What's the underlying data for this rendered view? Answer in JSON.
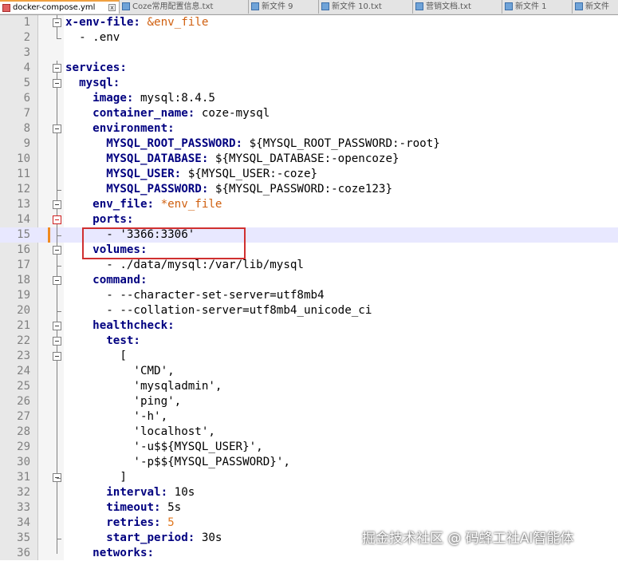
{
  "tabs": [
    {
      "label": "docker-compose.yml",
      "active": true
    },
    {
      "label": "Coze常用配置信息.txt",
      "active": false
    },
    {
      "label": "新文件 9",
      "active": false
    },
    {
      "label": "新文件 10.txt",
      "active": false
    },
    {
      "label": "营销文档.txt",
      "active": false
    },
    {
      "label": "新文件 1",
      "active": false
    },
    {
      "label": "新文件",
      "active": false
    }
  ],
  "tab_close_glyph": "x",
  "current_line": 15,
  "lines": [
    {
      "n": "1",
      "parts": [
        [
          "k",
          "x-env-file:"
        ],
        [
          "p",
          " "
        ],
        [
          "anc",
          "&env_file"
        ]
      ]
    },
    {
      "n": "2",
      "parts": [
        [
          "p",
          "  - .env"
        ]
      ]
    },
    {
      "n": "3",
      "parts": []
    },
    {
      "n": "4",
      "parts": [
        [
          "k",
          "services:"
        ]
      ]
    },
    {
      "n": "5",
      "parts": [
        [
          "p",
          "  "
        ],
        [
          "k",
          "mysql:"
        ]
      ]
    },
    {
      "n": "6",
      "parts": [
        [
          "p",
          "    "
        ],
        [
          "k",
          "image:"
        ],
        [
          "p",
          " mysql:8.4.5"
        ]
      ]
    },
    {
      "n": "7",
      "parts": [
        [
          "p",
          "    "
        ],
        [
          "k",
          "container_name:"
        ],
        [
          "p",
          " coze-mysql"
        ]
      ]
    },
    {
      "n": "8",
      "parts": [
        [
          "p",
          "    "
        ],
        [
          "k",
          "environment:"
        ]
      ]
    },
    {
      "n": "9",
      "parts": [
        [
          "p",
          "      "
        ],
        [
          "k",
          "MYSQL_ROOT_PASSWORD:"
        ],
        [
          "p",
          " ${MYSQL_ROOT_PASSWORD:-root}"
        ]
      ]
    },
    {
      "n": "10",
      "parts": [
        [
          "p",
          "      "
        ],
        [
          "k",
          "MYSQL_DATABASE:"
        ],
        [
          "p",
          " ${MYSQL_DATABASE:-opencoze}"
        ]
      ]
    },
    {
      "n": "11",
      "parts": [
        [
          "p",
          "      "
        ],
        [
          "k",
          "MYSQL_USER:"
        ],
        [
          "p",
          " ${MYSQL_USER:-coze}"
        ]
      ]
    },
    {
      "n": "12",
      "parts": [
        [
          "p",
          "      "
        ],
        [
          "k",
          "MYSQL_PASSWORD:"
        ],
        [
          "p",
          " ${MYSQL_PASSWORD:-coze123}"
        ]
      ]
    },
    {
      "n": "13",
      "parts": [
        [
          "p",
          "    "
        ],
        [
          "k",
          "env_file:"
        ],
        [
          "p",
          " "
        ],
        [
          "anc",
          "*env_file"
        ]
      ]
    },
    {
      "n": "14",
      "parts": [
        [
          "p",
          "    "
        ],
        [
          "k",
          "ports:"
        ]
      ]
    },
    {
      "n": "15",
      "parts": [
        [
          "p",
          "      - '3366:3306'"
        ]
      ]
    },
    {
      "n": "16",
      "parts": [
        [
          "p",
          "    "
        ],
        [
          "k",
          "volumes:"
        ]
      ]
    },
    {
      "n": "17",
      "parts": [
        [
          "p",
          "      - ./data/mysql:/var/lib/mysql"
        ]
      ]
    },
    {
      "n": "18",
      "parts": [
        [
          "p",
          "    "
        ],
        [
          "k",
          "command:"
        ]
      ]
    },
    {
      "n": "19",
      "parts": [
        [
          "p",
          "      - --character-set-server=utf8mb4"
        ]
      ]
    },
    {
      "n": "20",
      "parts": [
        [
          "p",
          "      - --collation-server=utf8mb4_unicode_ci"
        ]
      ]
    },
    {
      "n": "21",
      "parts": [
        [
          "p",
          "    "
        ],
        [
          "k",
          "healthcheck:"
        ]
      ]
    },
    {
      "n": "22",
      "parts": [
        [
          "p",
          "      "
        ],
        [
          "k",
          "test:"
        ]
      ]
    },
    {
      "n": "23",
      "parts": [
        [
          "p",
          "        ["
        ]
      ]
    },
    {
      "n": "24",
      "parts": [
        [
          "p",
          "          'CMD',"
        ]
      ]
    },
    {
      "n": "25",
      "parts": [
        [
          "p",
          "          'mysqladmin',"
        ]
      ]
    },
    {
      "n": "26",
      "parts": [
        [
          "p",
          "          'ping',"
        ]
      ]
    },
    {
      "n": "27",
      "parts": [
        [
          "p",
          "          '-h',"
        ]
      ]
    },
    {
      "n": "28",
      "parts": [
        [
          "p",
          "          'localhost',"
        ]
      ]
    },
    {
      "n": "29",
      "parts": [
        [
          "p",
          "          '-u$${MYSQL_USER}',"
        ]
      ]
    },
    {
      "n": "30",
      "parts": [
        [
          "p",
          "          '-p$${MYSQL_PASSWORD}',"
        ]
      ]
    },
    {
      "n": "31",
      "parts": [
        [
          "p",
          "        ]"
        ]
      ]
    },
    {
      "n": "32",
      "parts": [
        [
          "p",
          "      "
        ],
        [
          "k",
          "interval:"
        ],
        [
          "p",
          " 10s"
        ]
      ]
    },
    {
      "n": "33",
      "parts": [
        [
          "p",
          "      "
        ],
        [
          "k",
          "timeout:"
        ],
        [
          "p",
          " 5s"
        ]
      ]
    },
    {
      "n": "34",
      "parts": [
        [
          "p",
          "      "
        ],
        [
          "k",
          "retries:"
        ],
        [
          "p",
          " "
        ],
        [
          "num",
          "5"
        ]
      ]
    },
    {
      "n": "35",
      "parts": [
        [
          "p",
          "      "
        ],
        [
          "k",
          "start_period:"
        ],
        [
          "p",
          " 30s"
        ]
      ]
    },
    {
      "n": "36",
      "parts": [
        [
          "p",
          "    "
        ],
        [
          "k",
          "networks:"
        ]
      ]
    }
  ],
  "watermark": "掘金技术社区 @ 码蜂工社AI智能体",
  "colors": {
    "key": "#000080",
    "anchor": "#d06010",
    "number": "#e07820",
    "highlight_box": "#d03030",
    "current_line_bg": "#e8e8ff"
  }
}
